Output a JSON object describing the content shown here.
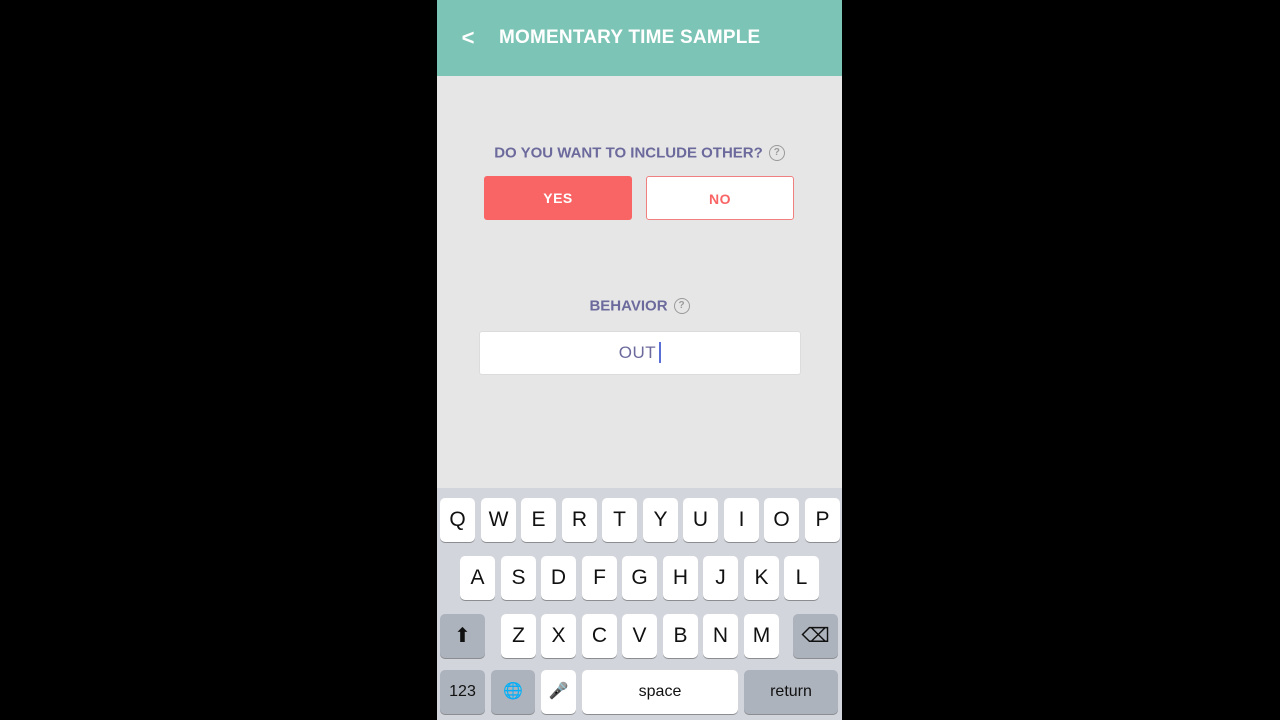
{
  "header": {
    "back_label": "<",
    "title": "MOMENTARY TIME SAMPLE",
    "background": "#7cc5b6"
  },
  "include_other": {
    "question": "DO YOU WANT TO INCLUDE OTHER?",
    "help_glyph": "?",
    "yes_label": "YES",
    "no_label": "NO",
    "selected": "YES",
    "accent": "#f96465"
  },
  "behavior": {
    "label": "BEHAVIOR",
    "help_glyph": "?",
    "value": "OUT"
  },
  "keyboard": {
    "row1": [
      "Q",
      "W",
      "E",
      "R",
      "T",
      "Y",
      "U",
      "I",
      "O",
      "P"
    ],
    "row2": [
      "A",
      "S",
      "D",
      "F",
      "G",
      "H",
      "J",
      "K",
      "L"
    ],
    "row3": [
      "Z",
      "X",
      "C",
      "V",
      "B",
      "N",
      "M"
    ],
    "shift_glyph": "⬆",
    "delete_glyph": "⌫",
    "numbers_label": "123",
    "globe_glyph": "🌐",
    "mic_glyph": "🎤",
    "space_label": "space",
    "return_label": "return"
  }
}
